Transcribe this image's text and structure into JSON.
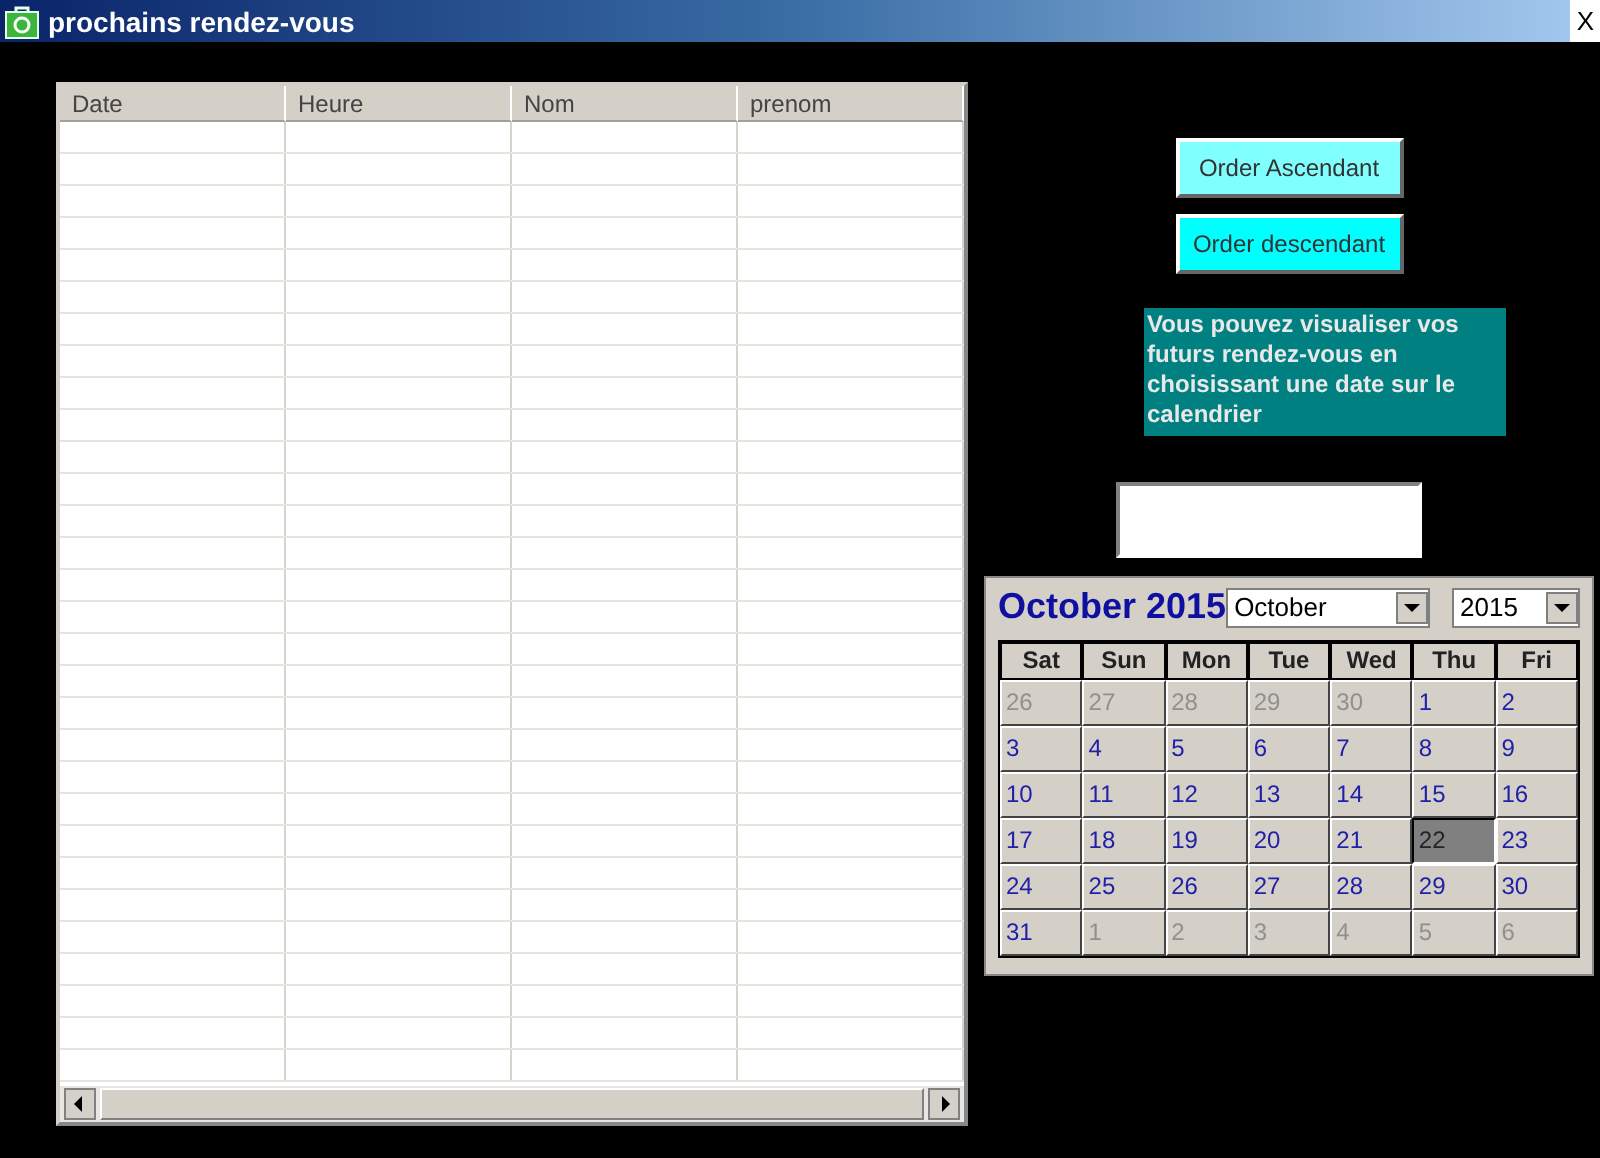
{
  "window": {
    "title": "prochains rendez-vous",
    "close": "X"
  },
  "table": {
    "columns": [
      "Date",
      "Heure",
      "Nom",
      "prenom"
    ]
  },
  "buttons": [
    {
      "label": "Order Ascendant",
      "kind": "pale"
    },
    {
      "label": "Order descendant",
      "kind": "bright"
    }
  ],
  "info": "Vous pouvez visualiser vos futurs rendez-vous en choisissant une date sur le calendrier",
  "calendar": {
    "title": "October 2015",
    "month": "October",
    "year": "2015",
    "weekdays": [
      "Sat",
      "Sun",
      "Mon",
      "Tue",
      "Wed",
      "Thu",
      "Fri"
    ],
    "days": [
      {
        "label": "26",
        "in_month": false,
        "selected": false
      },
      {
        "label": "27",
        "in_month": false,
        "selected": false
      },
      {
        "label": "28",
        "in_month": false,
        "selected": false
      },
      {
        "label": "29",
        "in_month": false,
        "selected": false
      },
      {
        "label": "30",
        "in_month": false,
        "selected": false
      },
      {
        "label": "1",
        "in_month": true,
        "selected": false
      },
      {
        "label": "2",
        "in_month": true,
        "selected": false
      },
      {
        "label": "3",
        "in_month": true,
        "selected": false
      },
      {
        "label": "4",
        "in_month": true,
        "selected": false
      },
      {
        "label": "5",
        "in_month": true,
        "selected": false
      },
      {
        "label": "6",
        "in_month": true,
        "selected": false
      },
      {
        "label": "7",
        "in_month": true,
        "selected": false
      },
      {
        "label": "8",
        "in_month": true,
        "selected": false
      },
      {
        "label": "9",
        "in_month": true,
        "selected": false
      },
      {
        "label": "10",
        "in_month": true,
        "selected": false
      },
      {
        "label": "11",
        "in_month": true,
        "selected": false
      },
      {
        "label": "12",
        "in_month": true,
        "selected": false
      },
      {
        "label": "13",
        "in_month": true,
        "selected": false
      },
      {
        "label": "14",
        "in_month": true,
        "selected": false
      },
      {
        "label": "15",
        "in_month": true,
        "selected": false
      },
      {
        "label": "16",
        "in_month": true,
        "selected": false
      },
      {
        "label": "17",
        "in_month": true,
        "selected": false
      },
      {
        "label": "18",
        "in_month": true,
        "selected": false
      },
      {
        "label": "19",
        "in_month": true,
        "selected": false
      },
      {
        "label": "20",
        "in_month": true,
        "selected": false
      },
      {
        "label": "21",
        "in_month": true,
        "selected": false
      },
      {
        "label": "22",
        "in_month": true,
        "selected": true
      },
      {
        "label": "23",
        "in_month": true,
        "selected": false
      },
      {
        "label": "24",
        "in_month": true,
        "selected": false
      },
      {
        "label": "25",
        "in_month": true,
        "selected": false
      },
      {
        "label": "26",
        "in_month": true,
        "selected": false
      },
      {
        "label": "27",
        "in_month": true,
        "selected": false
      },
      {
        "label": "28",
        "in_month": true,
        "selected": false
      },
      {
        "label": "29",
        "in_month": true,
        "selected": false
      },
      {
        "label": "30",
        "in_month": true,
        "selected": false
      },
      {
        "label": "31",
        "in_month": true,
        "selected": false
      },
      {
        "label": "1",
        "in_month": false,
        "selected": false
      },
      {
        "label": "2",
        "in_month": false,
        "selected": false
      },
      {
        "label": "3",
        "in_month": false,
        "selected": false
      },
      {
        "label": "4",
        "in_month": false,
        "selected": false
      },
      {
        "label": "5",
        "in_month": false,
        "selected": false
      },
      {
        "label": "6",
        "in_month": false,
        "selected": false
      }
    ]
  }
}
